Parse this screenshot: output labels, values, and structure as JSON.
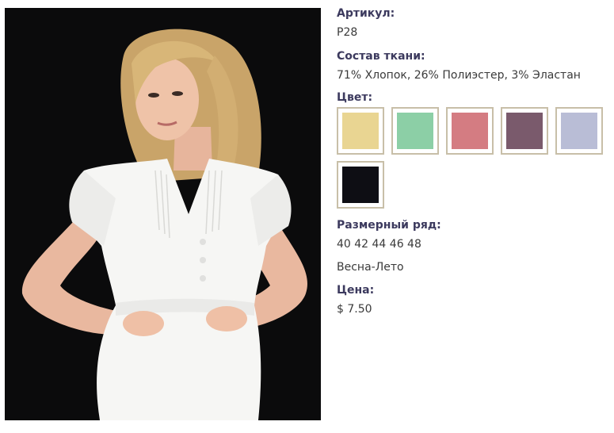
{
  "product": {
    "image_alt": "Белая блузка с коротким рукавом",
    "sku_label": "Артикул:",
    "sku_value": "P28",
    "fabric_label": "Состав ткани:",
    "fabric_value": "71% Хлопок, 26% Полиэстер, 3% Эластан",
    "color_label": "Цвет:",
    "colors": [
      {
        "hex": "#e9d592"
      },
      {
        "hex": "#8ccfa6"
      },
      {
        "hex": "#d47c82"
      },
      {
        "hex": "#7a5a6c"
      },
      {
        "hex": "#b9bdd6"
      },
      {
        "hex": "#0e0e14"
      }
    ],
    "size_label": "Размерный ряд:",
    "size_value": "40 42 44 46 48",
    "season": "Весна-Лето",
    "price_label": "Цена:",
    "price_value": "$ 7.50"
  }
}
